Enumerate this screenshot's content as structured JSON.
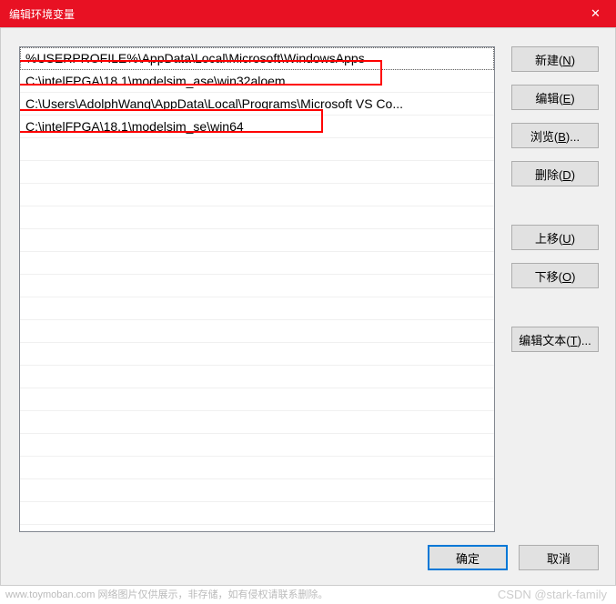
{
  "title": "编辑环境变量",
  "paths": [
    "%USERPROFILE%\\AppData\\Local\\Microsoft\\WindowsApps",
    "C:\\intelFPGA\\18.1\\modelsim_ase\\win32aloem",
    "C:\\Users\\AdolphWang\\AppData\\Local\\Programs\\Microsoft VS Co...",
    "C:\\intelFPGA\\18.1\\modelsim_se\\win64"
  ],
  "buttons": {
    "new": "新建(N)",
    "edit": "编辑(E)",
    "browse": "浏览(B)...",
    "delete": "删除(D)",
    "moveup": "上移(U)",
    "movedown": "下移(O)",
    "edittext": "编辑文本(T)...",
    "ok": "确定",
    "cancel": "取消"
  },
  "watermark_left": "www.toymoban.com 网络图片仅供展示，非存储，如有侵权请联系删除。",
  "watermark_right": "CSDN @stark-family"
}
